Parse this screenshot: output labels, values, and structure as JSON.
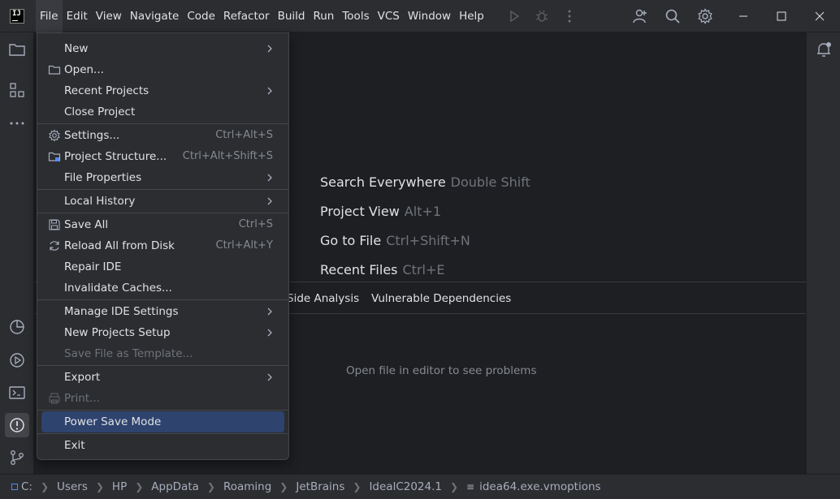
{
  "titlebar": {
    "logo_text": "IJ",
    "menus": [
      "File",
      "Edit",
      "View",
      "Navigate",
      "Code",
      "Refactor",
      "Build",
      "Run",
      "Tools",
      "VCS",
      "Window",
      "Help"
    ],
    "icons": [
      "run-icon",
      "debug-icon",
      "more-vert-icon",
      "add-user-icon",
      "search-icon",
      "settings-icon"
    ],
    "window_controls": [
      "minimize-icon",
      "maximize-icon",
      "close-icon"
    ]
  },
  "file_menu": {
    "items": [
      {
        "label": "New",
        "submenu": true
      },
      {
        "label": "Open...",
        "icon": "folder-icon"
      },
      {
        "label": "Recent Projects",
        "submenu": true
      },
      {
        "label": "Close Project"
      },
      {
        "label": "Settings...",
        "icon": "gear-icon",
        "shortcut": "Ctrl+Alt+S"
      },
      {
        "label": "Project Structure...",
        "icon": "project-structure-icon",
        "shortcut": "Ctrl+Alt+Shift+S"
      },
      {
        "label": "File Properties",
        "submenu": true
      },
      {
        "label": "Local History",
        "submenu": true
      },
      {
        "label": "Save All",
        "icon": "save-icon",
        "shortcut": "Ctrl+S"
      },
      {
        "label": "Reload All from Disk",
        "icon": "reload-icon",
        "shortcut": "Ctrl+Alt+Y"
      },
      {
        "label": "Repair IDE"
      },
      {
        "label": "Invalidate Caches..."
      },
      {
        "label": "Manage IDE Settings",
        "submenu": true
      },
      {
        "label": "New Projects Setup",
        "submenu": true
      },
      {
        "label": "Save File as Template...",
        "disabled": true
      },
      {
        "label": "Export",
        "submenu": true
      },
      {
        "label": "Print...",
        "icon": "print-icon",
        "disabled": true
      },
      {
        "label": "Power Save Mode",
        "selected": true
      },
      {
        "label": "Exit"
      }
    ]
  },
  "editor_hints": [
    {
      "label": "Search Everywhere",
      "key": "Double Shift"
    },
    {
      "label": "Project View",
      "key": "Alt+1"
    },
    {
      "label": "Go to File",
      "key": "Ctrl+Shift+N"
    },
    {
      "label": "Recent Files",
      "key": "Ctrl+E"
    }
  ],
  "problems": {
    "tabs": [
      "Side Analysis",
      "Vulnerable Dependencies"
    ],
    "empty_message": "Open file in editor to see problems"
  },
  "statusbar": {
    "drive": "C:",
    "path": [
      "Users",
      "HP",
      "AppData",
      "Roaming",
      "JetBrains",
      "IdealC2024.1"
    ],
    "file": "idea64.exe.vmoptions"
  },
  "colors": {
    "background": "#1e1f22",
    "panel": "#2b2d30",
    "selection": "#2e436e",
    "text": "#dfe1e5",
    "muted": "#6f737a"
  }
}
